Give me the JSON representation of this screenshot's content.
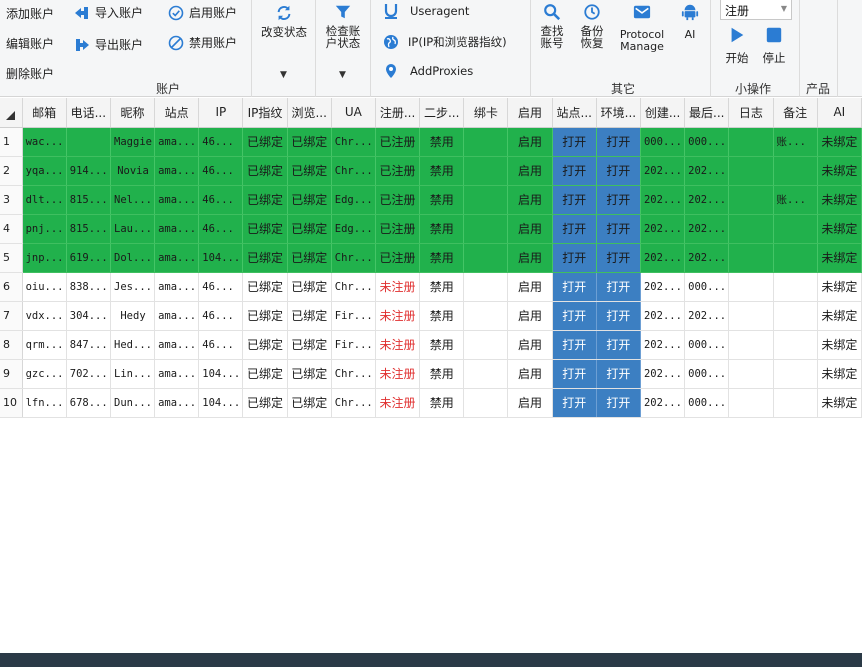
{
  "ribbon": {
    "account_group": {
      "label": "账户",
      "add": "添加账户",
      "edit": "编辑账户",
      "delete": "删除账户",
      "import": "导入账户",
      "export": "导出账户",
      "enable": "启用账户",
      "disable": "禁用账户"
    },
    "change_status": "改变状态",
    "check_status": "检查账户状态",
    "check_status_line1": "检查账",
    "check_status_line2": "户状态",
    "useragent": "Useragent",
    "ip_fingerprint": "IP(IP和浏览器指纹)",
    "add_proxies": "AddProxies",
    "other_group": {
      "label": "其它",
      "find_line1": "查找",
      "find_line2": "账号",
      "backup_line1": "备份",
      "backup_line2": "恢复",
      "protocol_line1": "Protocol",
      "protocol_line2": "Manage",
      "ai": "AI"
    },
    "mini_group": {
      "label": "小操作",
      "mode_select": "注册",
      "start": "开始",
      "stop": "停止"
    },
    "product_group": {
      "label": "产品"
    }
  },
  "table": {
    "columns": [
      "邮箱",
      "电话...",
      "昵称",
      "站点",
      "IP",
      "IP指纹",
      "浏览...",
      "UA",
      "注册...",
      "二步...",
      "绑卡",
      "启用",
      "站点...",
      "环境...",
      "创建...",
      "最后...",
      "日志",
      "备注",
      "AI"
    ],
    "rows": [
      {
        "no": "1",
        "email": "wac...",
        "phone": "",
        "nick": "Maggie",
        "site": "ama...",
        "ip": "46...",
        "ipfp": "已绑定",
        "browser": "已绑定",
        "ua": "Chr...",
        "reg": "已注册",
        "twostep": "禁用",
        "card": "",
        "enabled": "启用",
        "site_open": "打开",
        "env_open": "打开",
        "created": "000...",
        "last": "000...",
        "log": "",
        "note": "账...",
        "ai": "未绑定"
      },
      {
        "no": "2",
        "email": "yqa...",
        "phone": "914...",
        "nick": "Novia",
        "site": "ama...",
        "ip": "46...",
        "ipfp": "已绑定",
        "browser": "已绑定",
        "ua": "Chr...",
        "reg": "已注册",
        "twostep": "禁用",
        "card": "",
        "enabled": "启用",
        "site_open": "打开",
        "env_open": "打开",
        "created": "202...",
        "last": "202...",
        "log": "",
        "note": "",
        "ai": "未绑定"
      },
      {
        "no": "3",
        "email": "dlt...",
        "phone": "815...",
        "nick": "Nel...",
        "site": "ama...",
        "ip": "46...",
        "ipfp": "已绑定",
        "browser": "已绑定",
        "ua": "Edg...",
        "reg": "已注册",
        "twostep": "禁用",
        "card": "",
        "enabled": "启用",
        "site_open": "打开",
        "env_open": "打开",
        "created": "202...",
        "last": "202...",
        "log": "",
        "note": "账...",
        "ai": "未绑定"
      },
      {
        "no": "4",
        "email": "pnj...",
        "phone": "815...",
        "nick": "Lau...",
        "site": "ama...",
        "ip": "46...",
        "ipfp": "已绑定",
        "browser": "已绑定",
        "ua": "Edg...",
        "reg": "已注册",
        "twostep": "禁用",
        "card": "",
        "enabled": "启用",
        "site_open": "打开",
        "env_open": "打开",
        "created": "202...",
        "last": "202...",
        "log": "",
        "note": "",
        "ai": "未绑定"
      },
      {
        "no": "5",
        "email": "jnp...",
        "phone": "619...",
        "nick": "Dol...",
        "site": "ama...",
        "ip": "104...",
        "ipfp": "已绑定",
        "browser": "已绑定",
        "ua": "Chr...",
        "reg": "已注册",
        "twostep": "禁用",
        "card": "",
        "enabled": "启用",
        "site_open": "打开",
        "env_open": "打开",
        "created": "202...",
        "last": "202...",
        "log": "",
        "note": "",
        "ai": "未绑定"
      },
      {
        "no": "6",
        "email": "oiu...",
        "phone": "838...",
        "nick": "Jes...",
        "site": "ama...",
        "ip": "46...",
        "ipfp": "已绑定",
        "browser": "已绑定",
        "ua": "Chr...",
        "reg": "未注册",
        "twostep": "禁用",
        "card": "",
        "enabled": "启用",
        "site_open": "打开",
        "env_open": "打开",
        "created": "202...",
        "last": "000...",
        "log": "",
        "note": "",
        "ai": "未绑定"
      },
      {
        "no": "7",
        "email": "vdx...",
        "phone": "304...",
        "nick": "Hedy",
        "site": "ama...",
        "ip": "46...",
        "ipfp": "已绑定",
        "browser": "已绑定",
        "ua": "Fir...",
        "reg": "未注册",
        "twostep": "禁用",
        "card": "",
        "enabled": "启用",
        "site_open": "打开",
        "env_open": "打开",
        "created": "202...",
        "last": "202...",
        "log": "",
        "note": "",
        "ai": "未绑定"
      },
      {
        "no": "8",
        "email": "qrm...",
        "phone": "847...",
        "nick": "Hed...",
        "site": "ama...",
        "ip": "46...",
        "ipfp": "已绑定",
        "browser": "已绑定",
        "ua": "Fir...",
        "reg": "未注册",
        "twostep": "禁用",
        "card": "",
        "enabled": "启用",
        "site_open": "打开",
        "env_open": "打开",
        "created": "202...",
        "last": "000...",
        "log": "",
        "note": "",
        "ai": "未绑定"
      },
      {
        "no": "9",
        "email": "gzc...",
        "phone": "702...",
        "nick": "Lin...",
        "site": "ama...",
        "ip": "104...",
        "ipfp": "已绑定",
        "browser": "已绑定",
        "ua": "Chr...",
        "reg": "未注册",
        "twostep": "禁用",
        "card": "",
        "enabled": "启用",
        "site_open": "打开",
        "env_open": "打开",
        "created": "202...",
        "last": "000...",
        "log": "",
        "note": "",
        "ai": "未绑定"
      },
      {
        "no": "10",
        "email": "lfn...",
        "phone": "678...",
        "nick": "Dun...",
        "site": "ama...",
        "ip": "104...",
        "ipfp": "已绑定",
        "browser": "已绑定",
        "ua": "Chr...",
        "reg": "未注册",
        "twostep": "禁用",
        "card": "",
        "enabled": "启用",
        "site_open": "打开",
        "env_open": "打开",
        "created": "202...",
        "last": "000...",
        "log": "",
        "note": "",
        "ai": "未绑定"
      }
    ]
  },
  "colors": {
    "registered_row": "#21b14c",
    "open_button": "#3c7fc2",
    "unregistered_text": "#e03030",
    "footer": "#2b3a47",
    "icon_blue": "#2b7cd3"
  }
}
